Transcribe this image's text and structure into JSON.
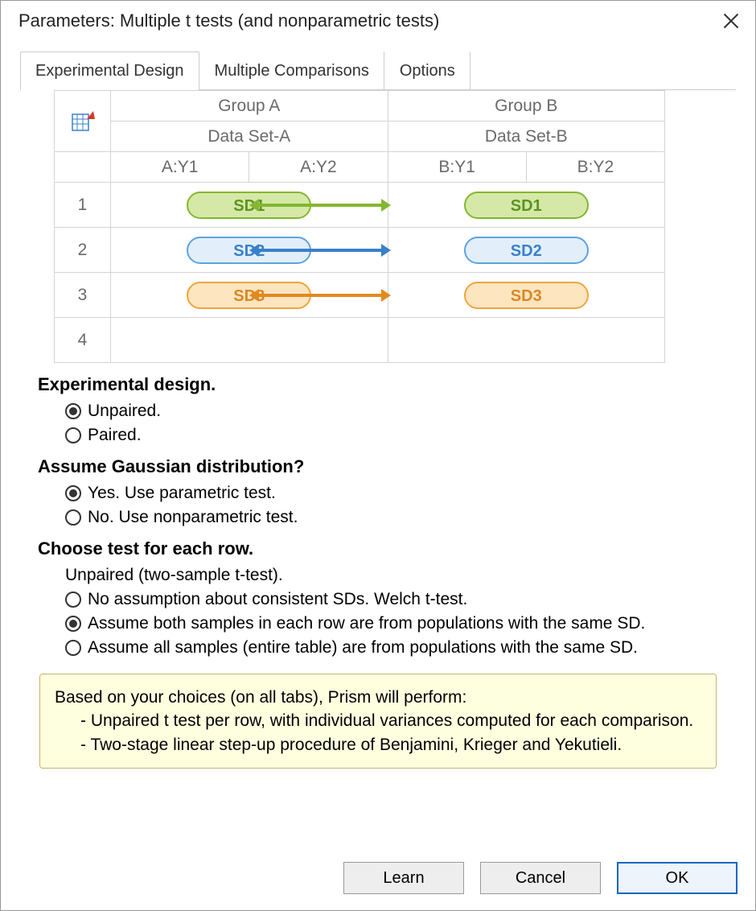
{
  "title": "Parameters: Multiple t tests (and nonparametric tests)",
  "tabs": {
    "t1": "Experimental Design",
    "t2": "Multiple Comparisons",
    "t3": "Options"
  },
  "table": {
    "groupA": "Group A",
    "groupB": "Group B",
    "dsA": "Data Set-A",
    "dsB": "Data Set-B",
    "ay1": "A:Y1",
    "ay2": "A:Y2",
    "by1": "B:Y1",
    "by2": "B:Y2",
    "r1": "1",
    "r2": "2",
    "r3": "3",
    "r4": "4",
    "sd1": "SD1",
    "sd2": "SD2",
    "sd3": "SD3"
  },
  "sec1": {
    "h": "Experimental design.",
    "o1": "Unpaired.",
    "o2": "Paired."
  },
  "sec2": {
    "h": "Assume Gaussian distribution?",
    "o1": "Yes. Use parametric test.",
    "o2": "No. Use nonparametric test."
  },
  "sec3": {
    "h": "Choose test for each row.",
    "sub": "Unpaired (two-sample t-test).",
    "o1": "No assumption about consistent SDs. Welch t-test.",
    "o2": "Assume both samples in each row are from populations with the same SD.",
    "o3": "Assume all samples (entire table) are from populations with the same SD."
  },
  "summary": {
    "l1": "Based on your choices (on all tabs), Prism will perform:",
    "l2": "- Unpaired t test per row, with individual variances computed for each comparison.",
    "l3": "- Two-stage linear step-up procedure of Benjamini, Krieger and Yekutieli."
  },
  "buttons": {
    "learn": "Learn",
    "cancel": "Cancel",
    "ok": "OK"
  }
}
